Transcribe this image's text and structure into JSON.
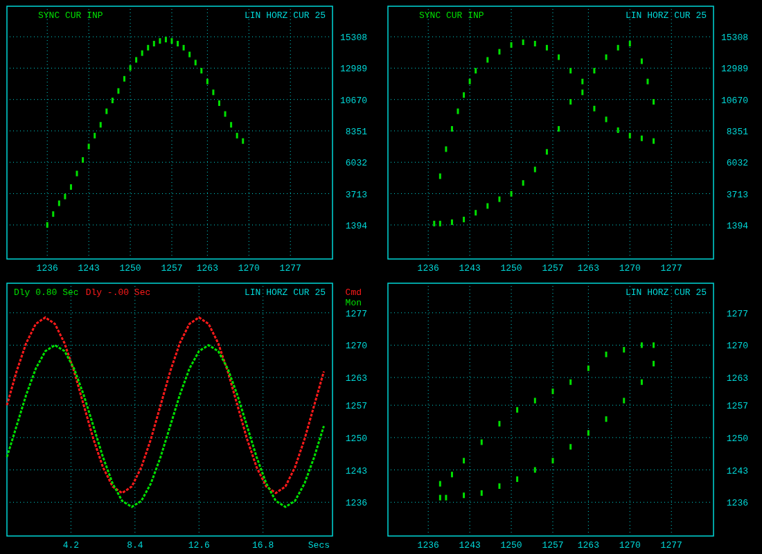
{
  "panels": [
    {
      "header_left": [
        {
          "text": "SYNC CUR INP",
          "color": "#00e000"
        }
      ],
      "header_right": "LIN HORZ CUR 25",
      "chart_data": {
        "type": "scatter",
        "xlim": [
          1229.2,
          1284.1
        ],
        "ylim": [
          -1120,
          17565
        ],
        "xticks": [
          1236,
          1243,
          1250,
          1257,
          1263,
          1270,
          1277
        ],
        "yticks": [
          1394,
          3713,
          6032,
          8351,
          10670,
          12989,
          15308
        ],
        "x": [
          1236,
          1237,
          1238,
          1239,
          1240,
          1241,
          1242,
          1243,
          1244,
          1245,
          1246,
          1247,
          1248,
          1249,
          1250,
          1251,
          1252,
          1253,
          1254,
          1255,
          1256,
          1257,
          1258,
          1259,
          1260,
          1261,
          1262,
          1263,
          1264,
          1265,
          1266,
          1267,
          1268,
          1269
        ],
        "grid": true,
        "series": [
          {
            "color": "#00e000",
            "values": [
              1400,
              2200,
              3000,
              3500,
              4200,
              5200,
              6200,
              7200,
              8000,
              8800,
              9800,
              10600,
              11300,
              12200,
              13000,
              13600,
              14100,
              14500,
              14800,
              15000,
              15100,
              15000,
              14800,
              14500,
              14000,
              13400,
              12800,
              12000,
              11200,
              10400,
              9600,
              8800,
              8000,
              7600
            ]
          }
        ]
      }
    },
    {
      "header_left": [
        {
          "text": "SYNC CUR INP",
          "color": "#00e000"
        }
      ],
      "header_right": "LIN HORZ CUR 25",
      "chart_data": {
        "type": "scatter",
        "xlim": [
          1229.2,
          1284.1
        ],
        "ylim": [
          -1120,
          17565
        ],
        "xticks": [
          1236,
          1243,
          1250,
          1257,
          1263,
          1270,
          1277
        ],
        "yticks": [
          1394,
          3713,
          6032,
          8351,
          10670,
          12989,
          15308
        ],
        "x": [
          1237,
          1238,
          1239,
          1240,
          1241,
          1242,
          1243,
          1244,
          1246,
          1248,
          1250,
          1252,
          1254,
          1256,
          1258,
          1260,
          1262,
          1264,
          1266,
          1268,
          1270,
          1272,
          1274,
          1274,
          1273,
          1272,
          1270,
          1268,
          1266,
          1264,
          1262,
          1260,
          1258,
          1256,
          1254,
          1252,
          1250,
          1248,
          1246,
          1244,
          1242,
          1240,
          1238
        ],
        "grid": true,
        "series": [
          {
            "color": "#00e000",
            "values": [
              1500,
              5000,
              7000,
              8500,
              9800,
              11000,
              12000,
              12800,
              13600,
              14200,
              14700,
              14900,
              14800,
              14500,
              13800,
              12800,
              11200,
              10000,
              9200,
              8400,
              8000,
              7800,
              7600,
              10500,
              12000,
              13500,
              14800,
              14500,
              13800,
              12800,
              12000,
              10500,
              8500,
              6800,
              5500,
              4500,
              3700,
              3300,
              2800,
              2300,
              1800,
              1600,
              1500
            ]
          }
        ]
      }
    },
    {
      "header_left": [
        {
          "text": "Dly 0.80 Sec",
          "color": "#00e000"
        },
        {
          "text": "Dly -.00 Sec",
          "color": "#ff1a1a"
        }
      ],
      "header_right": "LIN HORZ CUR 25",
      "chart_data": {
        "type": "line",
        "xlabel": "Secs",
        "xlim": [
          0,
          21.36
        ],
        "ylim": [
          1228.7,
          1283.4
        ],
        "xticks": [
          4.2,
          8.4,
          12.6,
          16.8
        ],
        "yticks": [
          1236,
          1243,
          1250,
          1257,
          1263,
          1270,
          1277
        ],
        "x": [
          0,
          0.63,
          1.26,
          1.89,
          2.52,
          3.15,
          3.78,
          4.41,
          5.04,
          5.67,
          6.3,
          6.93,
          7.56,
          8.19,
          8.82,
          9.45,
          10.08,
          10.71,
          11.34,
          11.97,
          12.6,
          13.23,
          13.86,
          14.49,
          15.12,
          15.75,
          16.38,
          17.01,
          17.64,
          18.27,
          18.9,
          19.53,
          20.16,
          20.79
        ],
        "grid": true,
        "series": [
          {
            "name": "Cmd",
            "color": "#ff1a1a",
            "line_style": "dashed",
            "values": [
              1257,
              1264.3,
              1270.4,
              1274.6,
              1276,
              1274.6,
              1270.4,
              1264.3,
              1257,
              1249.7,
              1243.6,
              1239.4,
              1238,
              1239.4,
              1243.6,
              1249.7,
              1257,
              1264.3,
              1270.4,
              1274.6,
              1276,
              1274.6,
              1270.4,
              1264.3,
              1257,
              1249.7,
              1243.6,
              1239.4,
              1238,
              1239.4,
              1243.6,
              1249.7,
              1257,
              1264.3
            ]
          },
          {
            "name": "Mon",
            "color": "#00e000",
            "line_style": "dashed",
            "values": [
              1245.8,
              1252.5,
              1259.2,
              1264.9,
              1268.7,
              1270,
              1268.7,
              1264.9,
              1259.2,
              1252.5,
              1245.8,
              1240.1,
              1236.3,
              1235,
              1236.3,
              1240.1,
              1245.8,
              1252.5,
              1259.2,
              1264.9,
              1268.7,
              1270,
              1268.7,
              1264.9,
              1259.2,
              1252.5,
              1245.8,
              1240.1,
              1236.3,
              1235,
              1236.3,
              1240.1,
              1245.8,
              1252.5
            ]
          }
        ]
      }
    },
    {
      "header_right": "LIN HORZ CUR 25",
      "chart_data": {
        "type": "scatter",
        "xlim": [
          1229.2,
          1284.1
        ],
        "ylim": [
          1228.7,
          1283.4
        ],
        "xticks": [
          1236,
          1243,
          1250,
          1257,
          1263,
          1270,
          1277
        ],
        "yticks": [
          1236,
          1243,
          1250,
          1257,
          1263,
          1270,
          1277
        ],
        "x": [
          1239,
          1242,
          1245,
          1248,
          1251,
          1254,
          1257,
          1260,
          1263,
          1266,
          1269,
          1272,
          1274,
          1274,
          1272,
          1269,
          1266,
          1263,
          1260,
          1257,
          1254,
          1251,
          1248,
          1245,
          1242,
          1240,
          1238,
          1238
        ],
        "grid": true,
        "series": [
          {
            "color": "#00e000",
            "values": [
              1237,
              1237.5,
              1238,
              1239.5,
              1241,
              1243,
              1245,
              1248,
              1251,
              1254,
              1258,
              1262,
              1266,
              1270,
              1270,
              1269,
              1268,
              1265,
              1262,
              1260,
              1258,
              1256,
              1253,
              1249,
              1245,
              1242,
              1240,
              1237
            ]
          }
        ]
      }
    }
  ]
}
